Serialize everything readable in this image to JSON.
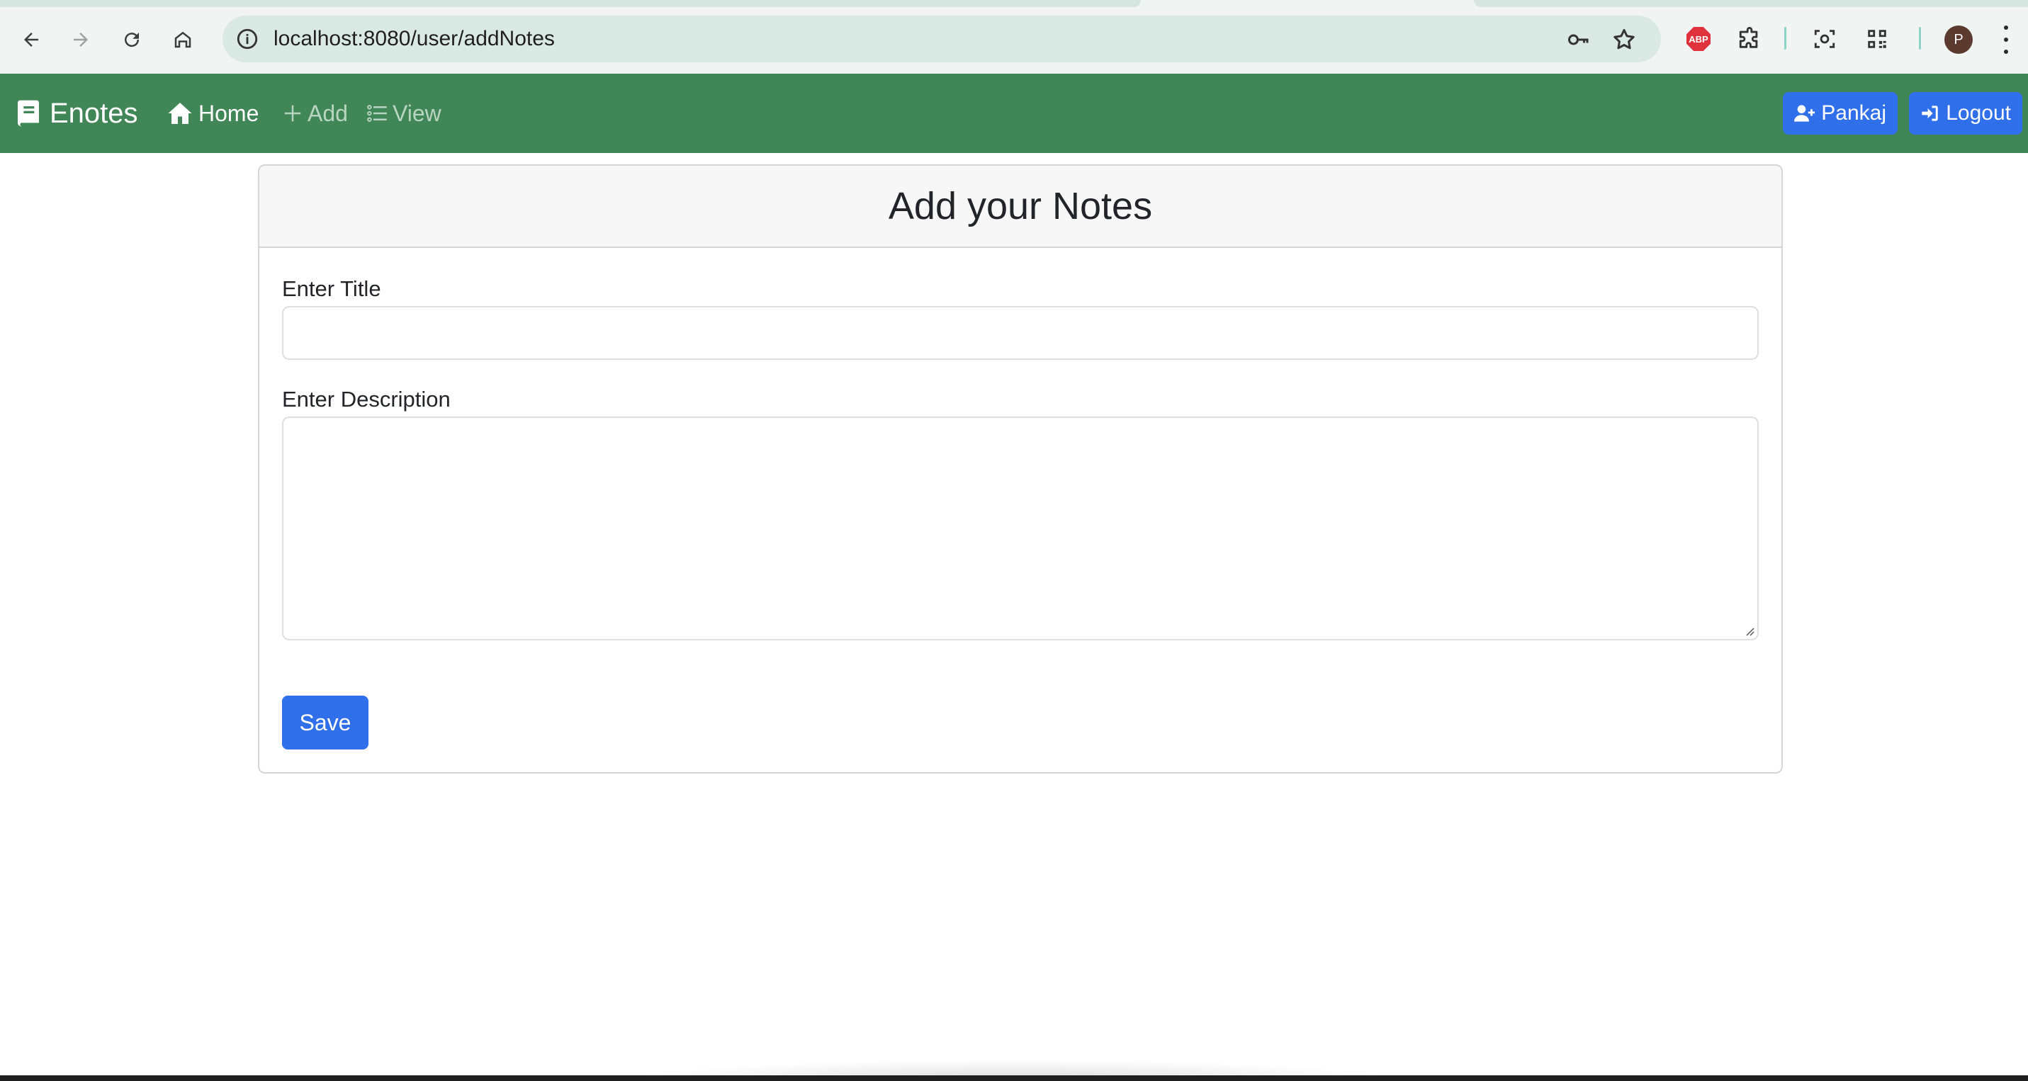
{
  "browser": {
    "url": "localhost:8080/user/addNotes",
    "profile_initial": "P",
    "abp_label": "ABP",
    "icons": {
      "back": "arrow-left-icon",
      "forward": "arrow-right-icon",
      "reload": "reload-icon",
      "home": "home-icon",
      "site_info": "info-icon",
      "password": "key-icon",
      "bookmark": "star-icon",
      "extensions": "puzzle-icon",
      "screenshot": "camera-scan-icon",
      "qr": "qr-code-icon",
      "menu": "kebab-menu-icon"
    }
  },
  "navbar": {
    "brand": "Enotes",
    "links": [
      {
        "label": "Home",
        "icon": "home-icon",
        "active": true
      },
      {
        "label": "Add",
        "icon": "plus-icon",
        "active": false
      },
      {
        "label": "View",
        "icon": "list-icon",
        "active": false
      }
    ],
    "user_button": "Pankaj",
    "logout_button": "Logout",
    "colors": {
      "bar": "#418657",
      "button": "#2f6fe9"
    }
  },
  "form": {
    "heading": "Add your Notes",
    "title_label": "Enter Title",
    "title_value": "",
    "description_label": "Enter Description",
    "description_value": "",
    "save_label": "Save"
  }
}
